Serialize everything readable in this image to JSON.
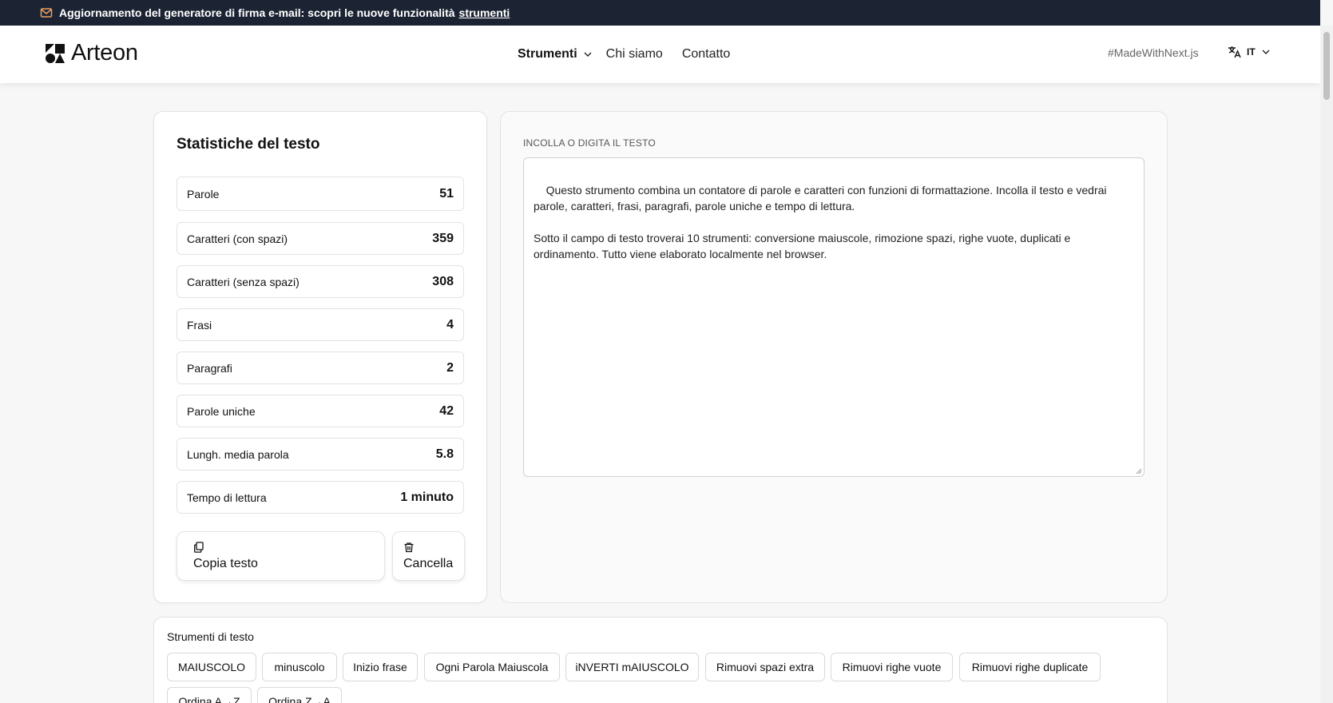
{
  "announcement": {
    "text": "Aggiornamento del generatore di firma e-mail: scopri le nuove funzionalità",
    "link_label": "strumenti"
  },
  "header": {
    "logo_text": "Arteon",
    "nav": [
      {
        "label": "Strumenti"
      },
      {
        "label": "Chi siamo"
      },
      {
        "label": "Contatto"
      }
    ],
    "made_with": "#MadeWithNext.js",
    "language": "IT"
  },
  "stats": {
    "title": "Statistiche del testo",
    "rows": [
      {
        "label": "Parole",
        "value": "51"
      },
      {
        "label": "Caratteri (con spazi)",
        "value": "359"
      },
      {
        "label": "Caratteri (senza spazi)",
        "value": "308"
      },
      {
        "label": "Frasi",
        "value": "4"
      },
      {
        "label": "Paragrafi",
        "value": "2"
      },
      {
        "label": "Parole uniche",
        "value": "42"
      },
      {
        "label": "Lungh. media parola",
        "value": "5.8"
      },
      {
        "label": "Tempo di lettura",
        "value": "1 minuto"
      }
    ],
    "copy_label": "Copia testo",
    "clear_label": "Cancella"
  },
  "editor": {
    "label": "INCOLLA O DIGITA IL TESTO",
    "text": "Questo strumento combina un contatore di parole e caratteri con funzioni di formattazione. Incolla il testo e vedrai parole, caratteri, frasi, paragrafi, parole uniche e tempo di lettura.\n\nSotto il campo di testo troverai 10 strumenti: conversione maiuscole, rimozione spazi, righe vuote, duplicati e ordinamento. Tutto viene elaborato localmente nel browser."
  },
  "tools": {
    "title": "Strumenti di testo",
    "items": [
      {
        "label": "MAIUSCOLO"
      },
      {
        "label": "minuscolo"
      },
      {
        "label": "Inizio frase"
      },
      {
        "label": "Ogni Parola Maiuscola"
      },
      {
        "label": "iNVERTI mAIUSCOLO"
      },
      {
        "label": "Rimuovi spazi extra"
      },
      {
        "label": "Rimuovi righe vuote"
      },
      {
        "label": "Rimuovi righe duplicate"
      },
      {
        "label": "Ordina A→Z"
      },
      {
        "label": "Ordina Z→A"
      }
    ]
  },
  "colors": {
    "announcement_bg": "#1c2433",
    "mail_icon": "#f0a060",
    "page_bg": "#f7f7f7"
  },
  "icons": {
    "mail": "mail-icon",
    "logo": "arteon-logo-icon",
    "chevron": "chevron-down-icon",
    "translate": "translate-icon",
    "copy": "copy-icon",
    "trash": "trash-icon"
  }
}
